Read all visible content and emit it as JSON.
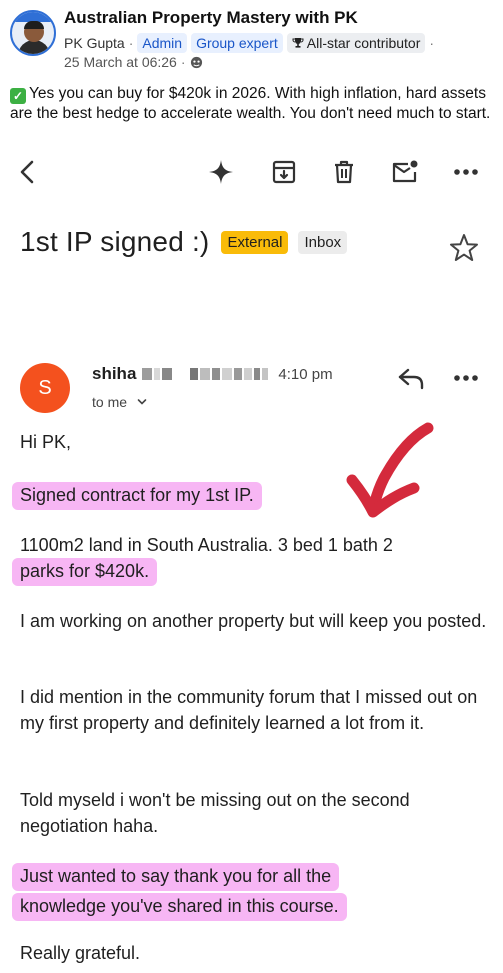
{
  "post": {
    "group_name": "Australian Property Mastery with PK",
    "author": "PK Gupta",
    "badges": [
      "Admin",
      "Group expert",
      "All-star contributor"
    ],
    "date": "25 March at 06:26",
    "text": "Yes you can buy for $420k in 2026. With high inflation, hard assets are the best hedge to accelerate wealth. You don't need much to start."
  },
  "email": {
    "subject": "1st IP signed :)",
    "labels": {
      "external": "External",
      "inbox": "Inbox"
    },
    "sender_initial": "S",
    "sender_name": "shiha",
    "time": "4:10 pm",
    "recipient": "to me",
    "greeting": "Hi PK,",
    "para1": "Signed contract for my 1st IP.",
    "para2_line1": "1100m2 land in South Australia. 3 bed 1 bath 2",
    "para2_line2": "parks for $420k.",
    "para3": "I am working on another property but will keep you posted.",
    "para4": "I did mention in the community forum that I missed out on my first property and definitely learned a lot from it.",
    "para5": "Told myseld i won't be missing out on the second negotiation haha.",
    "para6_line1": "Just wanted to say thank you for all the",
    "para6_line2": "knowledge you've shared in this course.",
    "closing": "Really grateful."
  },
  "icons": {
    "back": "chevron-left-icon",
    "gemini": "sparkle-icon",
    "archive": "archive-icon",
    "delete": "trash-icon",
    "mark_unread": "mail-unread-icon",
    "more": "more-horizontal-icon",
    "star": "star-outline-icon",
    "reply": "reply-icon",
    "expand": "chevron-down-icon"
  },
  "colors": {
    "highlight": "#f7b6f4",
    "external_label": "#f9bb09",
    "avatar": "#f4511e",
    "arrow": "#d42a3c",
    "check": "#3cb043"
  }
}
